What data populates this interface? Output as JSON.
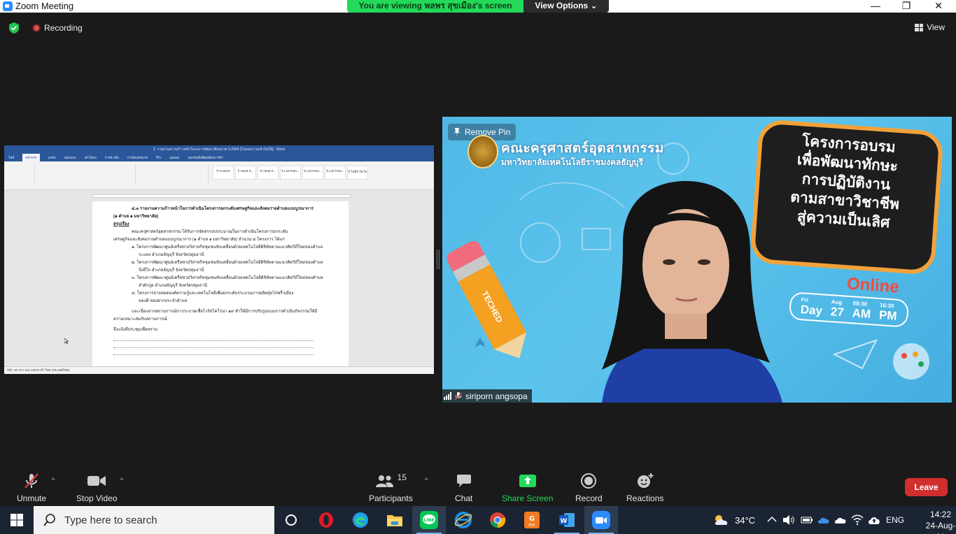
{
  "window": {
    "title": "Zoom Meeting",
    "minimize": "—",
    "restore": "❐",
    "close": "✕"
  },
  "banner": {
    "viewing_text": "You are viewing พลพร สุขเมือง's screen",
    "view_options": "View Options ⌄"
  },
  "top": {
    "recording": "Recording",
    "view": "View"
  },
  "shared_word": {
    "title": "1. รายงานความก้าวหน้าโครงการพัฒนาศักยภาพ 3-2564 [โหมดความเข้ากันได้] - Word",
    "tabs": [
      "ไฟล์",
      "หน้าแรก",
      "แทรก",
      "ออกแบบ",
      "เค้าโครง",
      "การอ้างอิง",
      "การส่งจดหมาย",
      "รีวิว",
      "มุมมอง",
      "บอกฉันสิ่งที่คุณต้องการทำ"
    ],
    "styles": [
      "¶ Content",
      "¶ Head S...",
      "¶ Head S...",
      "¶ List Para...",
      "¶ List Para...",
      "¶ List Para...",
      "¶ ไม่มีการเว้น"
    ],
    "doc_lines": [
      "๔.๓ รายงานความก้าวหน้าในการดำเนินโครงการยกระดับเศรษฐกิจและสังคมรายตำบลแบบบูรณาการ",
      "(๑ ตำบล ๑ มหาวิทยาลัย)",
      "สรุปเรื่อง",
      "คณะครุศาสตร์อุตสาหกรรม ได้รับการจัดสรรงบประมาณในการดำเนินโครงการยกระดับ",
      "เศรษฐกิจและสังคมรายตำบลแบบบูรณาการ (๑ ตำบล ๑ มหาวิทยาลัย) จำนวน ๔ โครงการ ได้แก่",
      "๑. โครงการพัฒนาศูนย์เครือข่ายวิสาหกิจชุมชนขับเคลื่อนด้วยเทคโนโลยีดิจิทัลตามแนวคิดวิถีใหม่ของตำบล",
      "ระแหง อำเภอธัญบุรี จังหวัดปทุมธานี",
      "๒. โครงการพัฒนาศูนย์เครือข่ายวิสาหกิจชุมชนขับเคลื่อนด้วยเทคโนโลยีดิจิทัลตามแนวคิดวิถีใหม่ของตำบล",
      "บึงยี่โถ อำเภอธัญบุรี จังหวัดปทุมธานี",
      "๓. โครงการพัฒนาศูนย์เครือข่ายวิสาหกิจชุมชนขับเคลื่อนด้วยเทคโนโลยีดิจิทัลตามแนวคิดวิถีใหม่ของตำบล",
      "ลำผักกูด อำเภอธัญบุรี จังหวัดปทุมธานี",
      "๔. โครงการถ่ายทอดองค์ความรู้และเทคโนโลยีเพื่อยกระดับกระบวนการผลิตสุ่มไก่พริ้วเมือง",
      "ของดี ของฝากประจำตำบล",
      "และเนื่องจากสถานการณ์การระบาดเชื้อไวรัสโคโรนา ๑๙ ทำให้มีการปรับรูปแบบการดำเนินกิจกรรมให้มี",
      "ความเหมาะสมกับสถานการณ์",
      "จึงแจ้งที่ประชุมเพื่อทราบ"
    ],
    "status": "หน้า 46 จาก 102    22670 คำ    ไทย (ประเทศไทย)"
  },
  "video": {
    "remove_pin": "Remove Pin",
    "school": "คณะครุศาสตร์อุตสาหกรรม",
    "university": "มหาวิทยาลัยเทคโนโลยีราชมงคลธัญบุรี",
    "bubble_lines": [
      "โครงการอบรม",
      "เพื่อพัฒนาทักษะ",
      "การปฏิบัติงาน",
      "ตามสาขาวิชาชีพ",
      "สู่ความเป็นเลิศ"
    ],
    "online": "Online",
    "date": {
      "dayname": "Fri",
      "day": "Day",
      "month": "Aug",
      "date": "27",
      "start": "08:30",
      "ampm1": "AM",
      "end": "16:30",
      "ampm2": "PM"
    },
    "pencil_text": "TECHED",
    "participant_name": "siriporn angsopa"
  },
  "toolbar": {
    "unmute": "Unmute",
    "stop_video": "Stop Video",
    "participants_count": "15",
    "participants": "Participants",
    "chat": "Chat",
    "share_screen": "Share Screen",
    "record": "Record",
    "reactions": "Reactions",
    "leave": "Leave",
    "caret": "^"
  },
  "taskbar": {
    "search_placeholder": "Type here to search",
    "weather": "34°C",
    "lang": "ENG",
    "time": "14:22",
    "date": "24-Aug-21"
  },
  "colors": {
    "zoom_blue": "#2d8cff",
    "banner_green": "#23d959",
    "leave_red": "#d12f2f",
    "word_blue": "#2b579a"
  }
}
